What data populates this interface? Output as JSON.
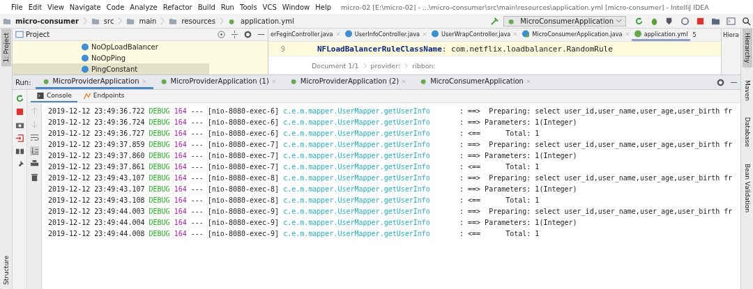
{
  "title_bar": {
    "menu": [
      "File",
      "Edit",
      "View",
      "Navigate",
      "Code",
      "Analyze",
      "Refactor",
      "Build",
      "Run",
      "Tools",
      "VCS",
      "Window",
      "Help"
    ],
    "title": "micro-02 [E:\\micro-02] - ...\\micro-consumer\\src\\main\\resources\\application.yml [micro-consumer] - IntelliJ IDEA"
  },
  "nav_bar": {
    "breadcrumb": [
      "micro-consumer",
      "src",
      "main",
      "resources",
      "application.yml"
    ],
    "run_config": "MicroConsumerApplication"
  },
  "left_stripe": {
    "top": "1: Project",
    "bottom": "Structure"
  },
  "project_panel": {
    "title": "Project",
    "items": [
      {
        "label": "NoOpLoadBalancer",
        "selected": false
      },
      {
        "label": "NoOpPing",
        "selected": false
      },
      {
        "label": "PingConstant",
        "selected": true
      }
    ]
  },
  "editor": {
    "tabs": [
      {
        "label": "erFeginController.java",
        "selected": false
      },
      {
        "label": "UserInfoController.java",
        "kind": "class",
        "selected": false
      },
      {
        "label": "UserWrapController.java",
        "kind": "class",
        "selected": false
      },
      {
        "label": "MicroConsumerApplication.java",
        "kind": "spring",
        "selected": false
      },
      {
        "label": "application.yml",
        "kind": "yaml",
        "selected": true
      }
    ],
    "overflow_count": "5",
    "line_number": "9",
    "key": "NFLoadBalancerRuleClassName",
    "value": ": com.netflix.loadbalancer.RandomRule",
    "breadcrumb": [
      "Document 1/1",
      "provider:",
      "ribbon:"
    ]
  },
  "hierarchy_panel": {
    "title": "Hiera"
  },
  "right_stripe": [
    {
      "label": "Hierarchy",
      "selected": true
    },
    {
      "label": "Maven",
      "selected": false
    },
    {
      "label": "Database",
      "selected": false
    },
    {
      "label": "Bean Validation",
      "selected": false
    }
  ],
  "run_panel": {
    "label": "Run:",
    "tabs": [
      {
        "label": "MicroProviderApplication",
        "selected": true
      },
      {
        "label": "MicroProviderApplication (1)",
        "selected": false
      },
      {
        "label": "MicroProviderApplication (2)",
        "selected": false
      },
      {
        "label": "MicroConsumerApplication",
        "selected": false
      }
    ],
    "subtabs": [
      {
        "label": "Console",
        "selected": true
      },
      {
        "label": "Endpoints",
        "selected": false
      }
    ],
    "lines": [
      {
        "timestamp": "2019-12-12 23:49:36.722",
        "level": "DEBUG",
        "pid": "164",
        "sep": "---",
        "thread": "[nio-8080-exec-6]",
        "logger": "c.e.m.mapper.UserMapper.getUserInfo",
        "message": ": ==>  Preparing: select user_id,user_name,user_age,user_birth fr"
      },
      {
        "timestamp": "2019-12-12 23:49:36.724",
        "level": "DEBUG",
        "pid": "164",
        "sep": "---",
        "thread": "[nio-8080-exec-6]",
        "logger": "c.e.m.mapper.UserMapper.getUserInfo",
        "message": ": ==> Parameters: 1(Integer)"
      },
      {
        "timestamp": "2019-12-12 23:49:36.727",
        "level": "DEBUG",
        "pid": "164",
        "sep": "---",
        "thread": "[nio-8080-exec-6]",
        "logger": "c.e.m.mapper.UserMapper.getUserInfo",
        "message": ": <==      Total: 1"
      },
      {
        "timestamp": "2019-12-12 23:49:37.859",
        "level": "DEBUG",
        "pid": "164",
        "sep": "---",
        "thread": "[nio-8080-exec-7]",
        "logger": "c.e.m.mapper.UserMapper.getUserInfo",
        "message": ": ==>  Preparing: select user_id,user_name,user_age,user_birth fr"
      },
      {
        "timestamp": "2019-12-12 23:49:37.860",
        "level": "DEBUG",
        "pid": "164",
        "sep": "---",
        "thread": "[nio-8080-exec-7]",
        "logger": "c.e.m.mapper.UserMapper.getUserInfo",
        "message": ": ==> Parameters: 1(Integer)"
      },
      {
        "timestamp": "2019-12-12 23:49:37.861",
        "level": "DEBUG",
        "pid": "164",
        "sep": "---",
        "thread": "[nio-8080-exec-7]",
        "logger": "c.e.m.mapper.UserMapper.getUserInfo",
        "message": ": <==      Total: 1"
      },
      {
        "timestamp": "2019-12-12 23:49:43.107",
        "level": "DEBUG",
        "pid": "164",
        "sep": "---",
        "thread": "[nio-8080-exec-8]",
        "logger": "c.e.m.mapper.UserMapper.getUserInfo",
        "message": ": ==>  Preparing: select user_id,user_name,user_age,user_birth fr"
      },
      {
        "timestamp": "2019-12-12 23:49:43.107",
        "level": "DEBUG",
        "pid": "164",
        "sep": "---",
        "thread": "[nio-8080-exec-8]",
        "logger": "c.e.m.mapper.UserMapper.getUserInfo",
        "message": ": ==> Parameters: 1(Integer)"
      },
      {
        "timestamp": "2019-12-12 23:49:43.108",
        "level": "DEBUG",
        "pid": "164",
        "sep": "---",
        "thread": "[nio-8080-exec-8]",
        "logger": "c.e.m.mapper.UserMapper.getUserInfo",
        "message": ": <==      Total: 1"
      },
      {
        "timestamp": "2019-12-12 23:49:44.003",
        "level": "DEBUG",
        "pid": "164",
        "sep": "---",
        "thread": "[nio-8080-exec-9]",
        "logger": "c.e.m.mapper.UserMapper.getUserInfo",
        "message": ": ==>  Preparing: select user_id,user_name,user_age,user_birth fr"
      },
      {
        "timestamp": "2019-12-12 23:49:44.004",
        "level": "DEBUG",
        "pid": "164",
        "sep": "---",
        "thread": "[nio-8080-exec-9]",
        "logger": "c.e.m.mapper.UserMapper.getUserInfo",
        "message": ": ==> Parameters: 1(Integer)"
      },
      {
        "timestamp": "2019-12-12 23:49:44.008",
        "level": "DEBUG",
        "pid": "164",
        "sep": "---",
        "thread": "[nio-8080-exec-9]",
        "logger": "c.e.m.mapper.UserMapper.getUserInfo",
        "message": ": <==      Total: 1"
      }
    ]
  }
}
